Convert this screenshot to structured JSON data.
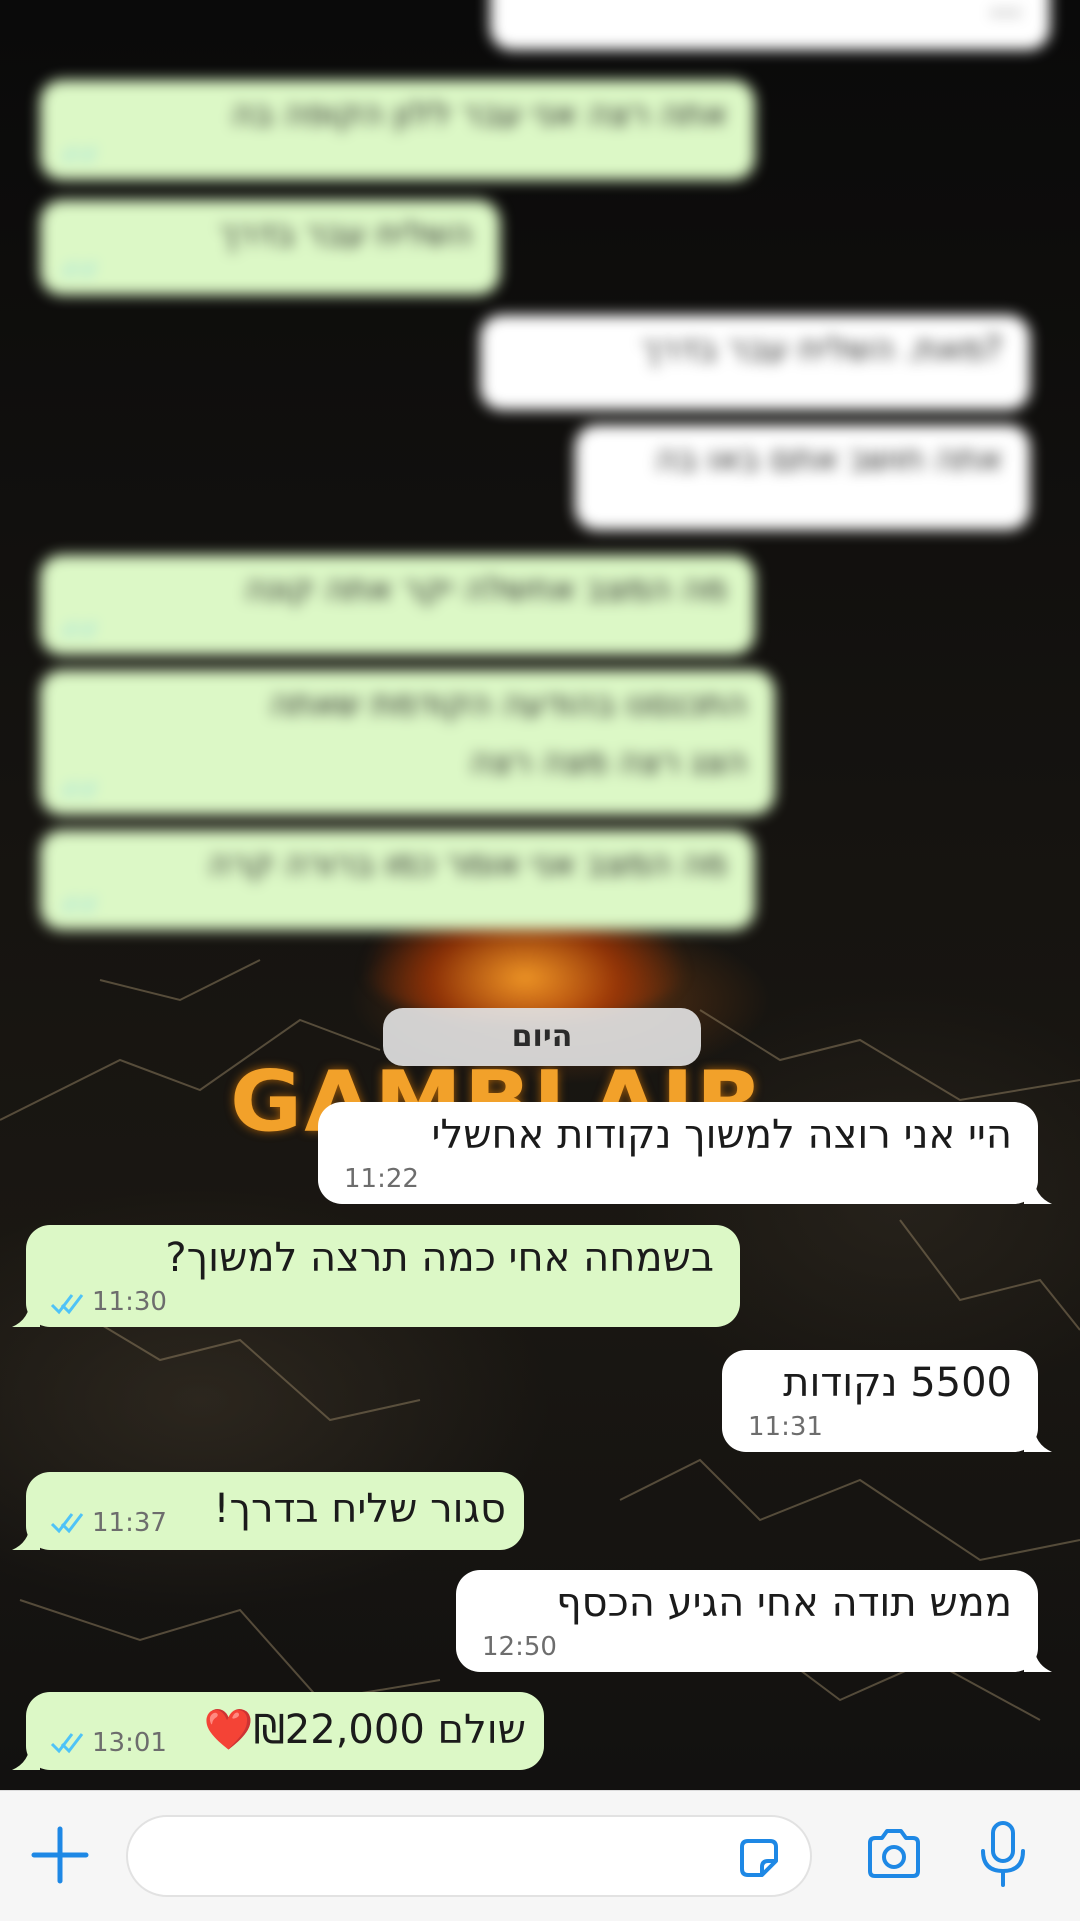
{
  "history_blurred": {
    "messages": [
      {
        "dir": "in",
        "text": "...",
        "time": ""
      },
      {
        "dir": "out",
        "text": "אתה רצה אני עבר ללון הקופה בה",
        "time": ""
      },
      {
        "dir": "out",
        "text": "השליח עבר בדרך",
        "time": ""
      },
      {
        "dir": "in",
        "text": "מאת. השליח עבר בדרך?",
        "time": ""
      },
      {
        "dir": "in",
        "text": "אתה חושב אתם באו בה",
        "time": ""
      },
      {
        "dir": "out",
        "text": "מה המצב אחשלה יקר אתה קונה",
        "time": ""
      },
      {
        "dir": "out",
        "text": "התכנסנו בהודעה הקודמת שאתה",
        "text2": "הצג רצה מצה רצה",
        "time": ""
      },
      {
        "dir": "out",
        "text": "מה המצב אני אומר כמו ברורה קרה",
        "time": ""
      }
    ]
  },
  "wallpaper": {
    "logo_text": "GAMBLAIR"
  },
  "date_chip": {
    "label": "היום"
  },
  "messages": [
    {
      "dir": "in",
      "text": "היי אני רוצה למשוך נקודות אחשלי",
      "time": "11:22"
    },
    {
      "dir": "out",
      "text": "בשמחה אחי כמה תרצה למשוך?",
      "time": "11:30",
      "read": true
    },
    {
      "dir": "in",
      "text": "5500 נקודות",
      "time": "11:31"
    },
    {
      "dir": "out",
      "text": "סגור שליח בדרך!",
      "time": "11:37",
      "read": true
    },
    {
      "dir": "in",
      "text": "ממש תודה אחי הגיע הכסף",
      "time": "12:50"
    },
    {
      "dir": "out",
      "text": "שולם ₪22,000❤️",
      "time": "13:01",
      "read": true
    }
  ],
  "input_bar": {
    "placeholder": "",
    "icons": [
      "plus-icon",
      "sticker-icon",
      "camera-icon",
      "microphone-icon"
    ]
  },
  "colors": {
    "outgoing_bubble": "#dcf8c6",
    "incoming_bubble": "#ffffff",
    "read_ticks": "#4fc3f7",
    "accent_blue": "#1e88e5"
  }
}
